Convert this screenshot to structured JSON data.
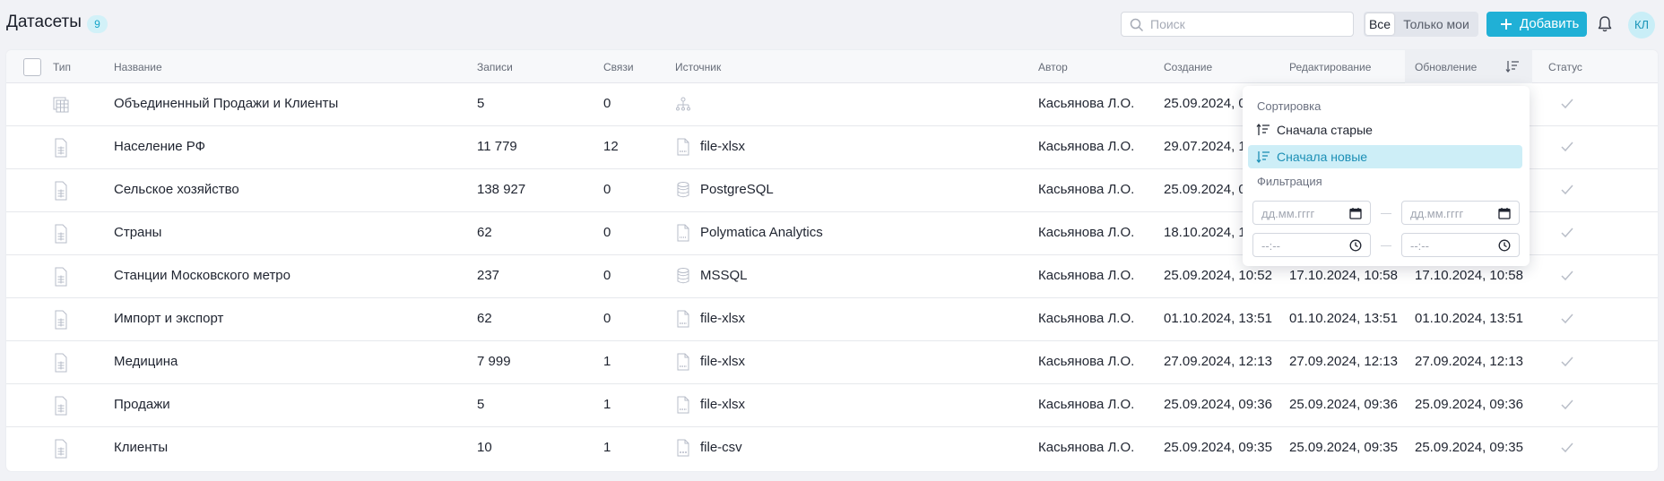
{
  "header": {
    "title": "Датасеты",
    "count": "9",
    "search_placeholder": "Поиск",
    "filter_all": "Все",
    "filter_mine": "Только мои",
    "add_label": "Добавить",
    "avatar_initials": "КЛ"
  },
  "table": {
    "columns": {
      "type": "Тип",
      "name": "Название",
      "records": "Записи",
      "links": "Связи",
      "source": "Источник",
      "author": "Автор",
      "created": "Создание",
      "edited": "Редактирование",
      "updated": "Обновление",
      "status": "Статус"
    },
    "rows": [
      {
        "type_icon": "table-join-icon",
        "name": "Объединенный Продажи и Клиенты",
        "records": "5",
        "links": "0",
        "source_icon": "hierarchy-icon",
        "source": "",
        "author": "Касьянова Л.О.",
        "created": "25.09.2024, 0",
        "edited": "",
        "updated": ""
      },
      {
        "type_icon": "document-icon",
        "name": "Население РФ",
        "records": "11 779",
        "links": "12",
        "source_icon": "xlsx-file-icon",
        "source": "file-xlsx",
        "author": "Касьянова Л.О.",
        "created": "29.07.2024, 1",
        "edited": "",
        "updated": ""
      },
      {
        "type_icon": "document-icon",
        "name": "Сельское хозяйство",
        "records": "138 927",
        "links": "0",
        "source_icon": "database-icon",
        "source": "PostgreSQL",
        "author": "Касьянова Л.О.",
        "created": "25.09.2024, 0",
        "edited": "",
        "updated": ""
      },
      {
        "type_icon": "document-icon",
        "name": "Страны",
        "records": "62",
        "links": "0",
        "source_icon": "api-file-icon",
        "source": "Polymatica Analytics",
        "author": "Касьянова Л.О.",
        "created": "18.10.2024, 1",
        "edited": "",
        "updated": ""
      },
      {
        "type_icon": "document-icon",
        "name": "Станции Московского метро",
        "records": "237",
        "links": "0",
        "source_icon": "database-icon",
        "source": "MSSQL",
        "author": "Касьянова Л.О.",
        "created": "25.09.2024, 10:52",
        "edited": "17.10.2024, 10:58",
        "updated": "17.10.2024, 10:58"
      },
      {
        "type_icon": "document-icon",
        "name": "Импорт и экспорт",
        "records": "62",
        "links": "0",
        "source_icon": "xlsx-file-icon",
        "source": "file-xlsx",
        "author": "Касьянова Л.О.",
        "created": "01.10.2024, 13:51",
        "edited": "01.10.2024, 13:51",
        "updated": "01.10.2024, 13:51"
      },
      {
        "type_icon": "document-icon",
        "name": "Медицина",
        "records": "7 999",
        "links": "1",
        "source_icon": "xlsx-file-icon",
        "source": "file-xlsx",
        "author": "Касьянова Л.О.",
        "created": "27.09.2024, 12:13",
        "edited": "27.09.2024, 12:13",
        "updated": "27.09.2024, 12:13"
      },
      {
        "type_icon": "document-icon",
        "name": "Продажи",
        "records": "5",
        "links": "1",
        "source_icon": "xlsx-file-icon",
        "source": "file-xlsx",
        "author": "Касьянова Л.О.",
        "created": "25.09.2024, 09:36",
        "edited": "25.09.2024, 09:36",
        "updated": "25.09.2024, 09:36"
      },
      {
        "type_icon": "document-icon",
        "name": "Клиенты",
        "records": "10",
        "links": "1",
        "source_icon": "csv-file-icon",
        "source": "file-csv",
        "author": "Касьянова Л.О.",
        "created": "25.09.2024, 09:35",
        "edited": "25.09.2024, 09:35",
        "updated": "25.09.2024, 09:35"
      }
    ]
  },
  "sort_menu": {
    "sort_heading": "Сортировка",
    "oldest_first": "Сначала старые",
    "newest_first": "Сначала новые",
    "filter_heading": "Фильтрация",
    "date_placeholder": "дд.мм.гггг",
    "time_placeholder": "--:--"
  },
  "colors": {
    "accent": "#20b0d6",
    "badge_bg": "#d2f1f8",
    "active_item_bg": "#cdeef7"
  }
}
